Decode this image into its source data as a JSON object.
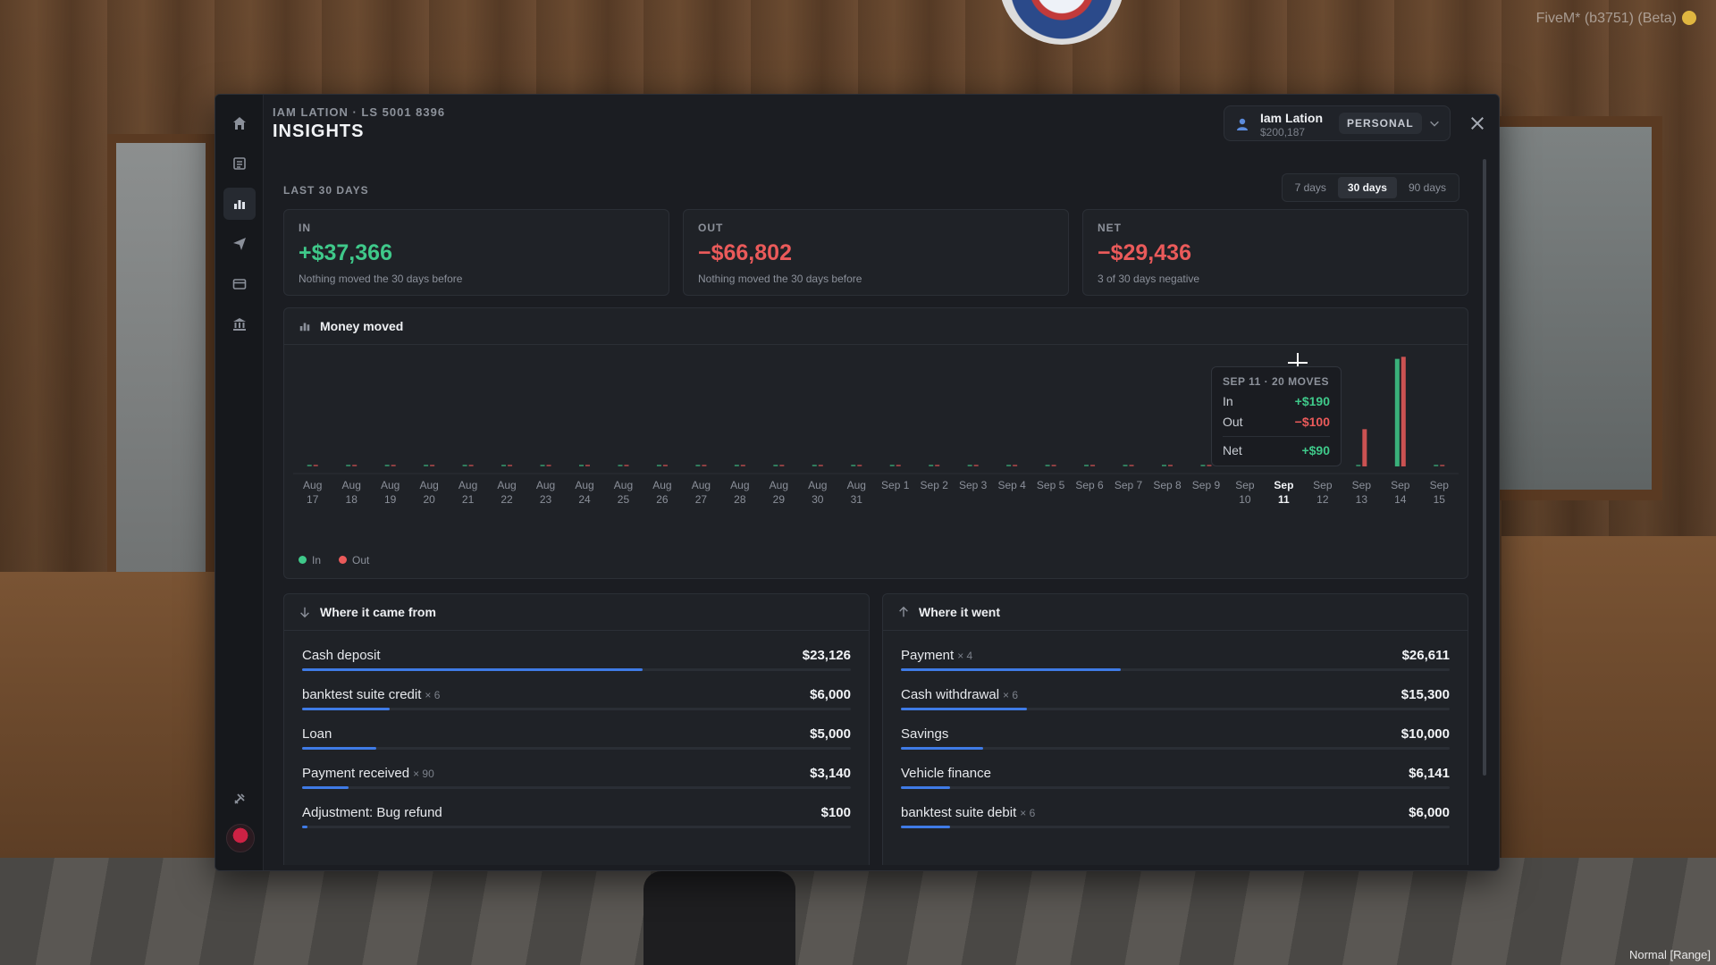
{
  "hud": {
    "top_right": "FiveM* (b3751) (Beta)",
    "bottom_right": "Normal [Range]"
  },
  "header": {
    "subtitle": "IAM LATION · LS 5001 8396",
    "title": "INSIGHTS"
  },
  "account": {
    "name": "Iam Lation",
    "balance": "$200,187",
    "type": "PERSONAL"
  },
  "range": {
    "label": "LAST 30 DAYS",
    "tabs": [
      "7 days",
      "30 days",
      "90 days"
    ],
    "active": "30 days"
  },
  "stats": {
    "in": {
      "label": "IN",
      "value": "+$37,366",
      "note": "Nothing moved the 30 days before"
    },
    "out": {
      "label": "OUT",
      "value": "−$66,802",
      "note": "Nothing moved the 30 days before"
    },
    "net": {
      "label": "NET",
      "value": "−$29,436",
      "note": "3 of 30 days negative"
    }
  },
  "chart_card": {
    "title": "Money moved",
    "legend": {
      "in": "In",
      "out": "Out"
    }
  },
  "tooltip": {
    "title": "SEP 11 · 20 MOVES",
    "in_label": "In",
    "in_value": "+$190",
    "out_label": "Out",
    "out_value": "−$100",
    "net_label": "Net",
    "net_value": "+$90"
  },
  "chart_data": {
    "type": "bar",
    "categories": [
      [
        "Aug",
        "17"
      ],
      [
        "Aug",
        "18"
      ],
      [
        "Aug",
        "19"
      ],
      [
        "Aug",
        "20"
      ],
      [
        "Aug",
        "21"
      ],
      [
        "Aug",
        "22"
      ],
      [
        "Aug",
        "23"
      ],
      [
        "Aug",
        "24"
      ],
      [
        "Aug",
        "25"
      ],
      [
        "Aug",
        "26"
      ],
      [
        "Aug",
        "27"
      ],
      [
        "Aug",
        "28"
      ],
      [
        "Aug",
        "29"
      ],
      [
        "Aug",
        "30"
      ],
      [
        "Aug",
        "31"
      ],
      [
        "Sep 1"
      ],
      [
        "Sep 2"
      ],
      [
        "Sep 3"
      ],
      [
        "Sep 4"
      ],
      [
        "Sep 5"
      ],
      [
        "Sep 6"
      ],
      [
        "Sep 7"
      ],
      [
        "Sep 8"
      ],
      [
        "Sep 9"
      ],
      [
        "Sep",
        "10"
      ],
      [
        "Sep",
        "11"
      ],
      [
        "Sep",
        "12"
      ],
      [
        "Sep",
        "13"
      ],
      [
        "Sep",
        "14"
      ],
      [
        "Sep",
        "15"
      ]
    ],
    "highlight_index": 25,
    "series": [
      {
        "name": "In",
        "color": "#3fc98a",
        "values": [
          0,
          0,
          0,
          0,
          0,
          0,
          0,
          0,
          0,
          0,
          0,
          0,
          0,
          0,
          0,
          0,
          0,
          0,
          0,
          0,
          0,
          0,
          0,
          0,
          0,
          190,
          1400,
          0,
          26000,
          0
        ]
      },
      {
        "name": "Out",
        "color": "#ea5a5a",
        "values": [
          0,
          0,
          0,
          0,
          0,
          0,
          0,
          0,
          0,
          0,
          0,
          0,
          0,
          0,
          0,
          0,
          0,
          0,
          0,
          0,
          0,
          0,
          0,
          0,
          0,
          100,
          3600,
          9000,
          26500,
          0
        ]
      }
    ],
    "ylim": [
      0,
      27000
    ]
  },
  "came_from": {
    "title": "Where it came from",
    "rows": [
      {
        "name": "Cash deposit",
        "count": "",
        "amount": "$23,126",
        "share": 0.62
      },
      {
        "name": "banktest suite credit",
        "count": "× 6",
        "amount": "$6,000",
        "share": 0.16
      },
      {
        "name": "Loan",
        "count": "",
        "amount": "$5,000",
        "share": 0.135
      },
      {
        "name": "Payment received",
        "count": "× 90",
        "amount": "$3,140",
        "share": 0.085
      },
      {
        "name": "Adjustment: Bug refund",
        "count": "",
        "amount": "$100",
        "share": 0.01
      }
    ]
  },
  "went": {
    "title": "Where it went",
    "rows": [
      {
        "name": "Payment",
        "count": "× 4",
        "amount": "$26,611",
        "share": 0.4
      },
      {
        "name": "Cash withdrawal",
        "count": "× 6",
        "amount": "$15,300",
        "share": 0.23
      },
      {
        "name": "Savings",
        "count": "",
        "amount": "$10,000",
        "share": 0.15
      },
      {
        "name": "Vehicle finance",
        "count": "",
        "amount": "$6,141",
        "share": 0.09
      },
      {
        "name": "banktest suite debit",
        "count": "× 6",
        "amount": "$6,000",
        "share": 0.09
      }
    ]
  },
  "colors": {
    "accent": "#3f7be6",
    "positive": "#3fc98a",
    "negative": "#ea5a5a"
  }
}
